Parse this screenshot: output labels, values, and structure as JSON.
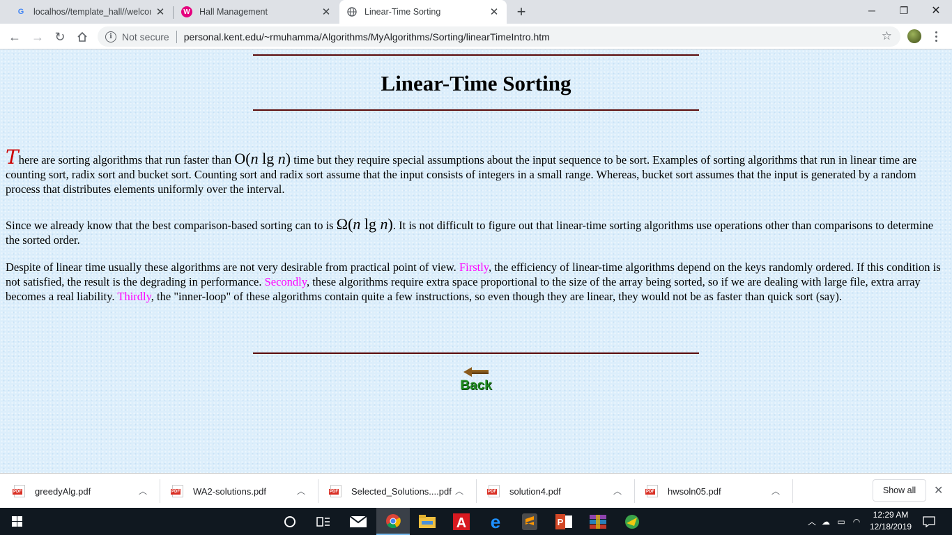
{
  "browser": {
    "tabs": [
      {
        "title": "localhos//template_hall//welcom",
        "favicon": "G"
      },
      {
        "title": "Hall Management",
        "favicon": "W"
      },
      {
        "title": "Linear-Time Sorting",
        "favicon": "globe"
      }
    ],
    "security_label": "Not secure",
    "url": "personal.kent.edu/~rmuhamma/Algorithms/MyAlgorithms/Sorting/linearTimeIntro.htm"
  },
  "page": {
    "title": "Linear-Time Sorting",
    "p1": {
      "dropcap": "T",
      "before_math": "here are sorting algorithms that run faster than ",
      "math_open": "O(",
      "math_n1": "n",
      "math_lg": " lg ",
      "math_n2": "n",
      "math_close": ")",
      "after_math": " time but they require special assumptions about the input sequence to be sort. Examples of sorting algorithms that run in linear time are counting sort, radix sort and bucket sort. Counting sort and radix sort assume that the input consists of integers in a small range. Whereas, bucket sort assumes that the input is generated by a random process that distributes elements uniformly over the interval."
    },
    "p2": {
      "before_math": "Since we already know that the best comparison-based sorting can to is ",
      "math_open": "Ω(",
      "math_n1": "n",
      "math_lg": " lg ",
      "math_n2": "n",
      "math_close": ")",
      "after_math": ". It is not difficult to figure out that linear-time sorting algorithms use operations other than comparisons to determine the sorted order."
    },
    "p3": {
      "intro": "Despite of linear time usually these algorithms are not very desirable from practical point of view. ",
      "firstly": "Firstly",
      "firstly_text": ", the efficiency of linear-time algorithms depend on the keys randomly ordered. If this condition is not satisfied, the result is the degrading in performance. ",
      "secondly": "Secondly",
      "secondly_text": ", these algorithms require extra space proportional to the size of the array being sorted, so if we are dealing with large file, extra array becomes a real liability. ",
      "thirdly": "Thirdly",
      "thirdly_text": ", the \"inner-loop\" of these algorithms contain quite a few instructions, so even though they are linear, they would not be as faster than quick sort (say)."
    },
    "back_label": "Back"
  },
  "downloads": {
    "items": [
      "greedyAlg.pdf",
      "WA2-solutions.pdf",
      "Selected_Solutions....pdf",
      "solution4.pdf",
      "hwsoln05.pdf"
    ],
    "file_badge": "PDF",
    "show_all": "Show all"
  },
  "taskbar": {
    "time": "12:29 AM",
    "date": "12/18/2019"
  },
  "colors": {
    "highlight": "#ff00ff",
    "dropcap": "#cc0000",
    "rule": "#5a0a0a"
  }
}
